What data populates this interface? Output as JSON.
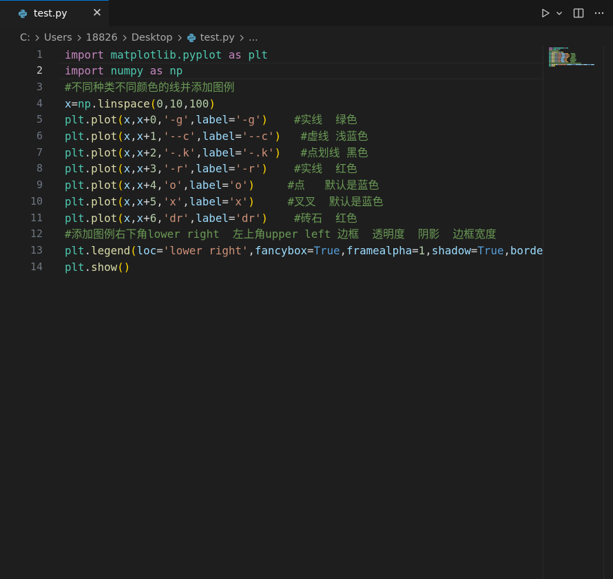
{
  "tab": {
    "label": "test.py",
    "close_glyph": "✕",
    "icon": "python-icon"
  },
  "toolbar": {
    "run_icon": "run-icon",
    "dropdown_icon": "chevron-down-icon",
    "split_icon": "split-editor-icon",
    "more_icon": "more-icon"
  },
  "breadcrumb": {
    "drive": "C:",
    "users": "Users",
    "user": "18826",
    "desktop": "Desktop",
    "file": "test.py",
    "more": "..."
  },
  "colors": {
    "accent": "#0078d4",
    "background": "#1e1e1e",
    "python_blue": "#519aba"
  },
  "editor": {
    "active_line": 2,
    "lines": [
      {
        "n": "1",
        "t": [
          [
            "kw",
            "import"
          ],
          [
            "op",
            " "
          ],
          [
            "mod",
            "matplotlib.pyplot"
          ],
          [
            "op",
            " "
          ],
          [
            "kw",
            "as"
          ],
          [
            "op",
            " "
          ],
          [
            "mod",
            "plt"
          ]
        ]
      },
      {
        "n": "2",
        "t": [
          [
            "kw",
            "import"
          ],
          [
            "op",
            " "
          ],
          [
            "mod",
            "numpy"
          ],
          [
            "op",
            " "
          ],
          [
            "kw",
            "as"
          ],
          [
            "op",
            " "
          ],
          [
            "mod",
            "np"
          ]
        ]
      },
      {
        "n": "3",
        "t": [
          [
            "cm",
            "#不同种类不同颜色的线并添加图例"
          ]
        ]
      },
      {
        "n": "4",
        "t": [
          [
            "var",
            "x"
          ],
          [
            "op",
            "="
          ],
          [
            "mod",
            "np"
          ],
          [
            "op",
            "."
          ],
          [
            "fn",
            "linspace"
          ],
          [
            "b1",
            "("
          ],
          [
            "num",
            "0"
          ],
          [
            "op",
            ","
          ],
          [
            "num",
            "10"
          ],
          [
            "op",
            ","
          ],
          [
            "num",
            "100"
          ],
          [
            "b1",
            ")"
          ]
        ]
      },
      {
        "n": "5",
        "t": [
          [
            "mod",
            "plt"
          ],
          [
            "op",
            "."
          ],
          [
            "fn",
            "plot"
          ],
          [
            "b1",
            "("
          ],
          [
            "var",
            "x"
          ],
          [
            "op",
            ","
          ],
          [
            "var",
            "x"
          ],
          [
            "op",
            "+"
          ],
          [
            "num",
            "0"
          ],
          [
            "op",
            ","
          ],
          [
            "str",
            "'-g'"
          ],
          [
            "op",
            ","
          ],
          [
            "var",
            "label"
          ],
          [
            "op",
            "="
          ],
          [
            "str",
            "'-g'"
          ],
          [
            "b1",
            ")"
          ],
          [
            "op",
            "    "
          ],
          [
            "cm",
            "#实线  绿色"
          ]
        ]
      },
      {
        "n": "6",
        "t": [
          [
            "mod",
            "plt"
          ],
          [
            "op",
            "."
          ],
          [
            "fn",
            "plot"
          ],
          [
            "b1",
            "("
          ],
          [
            "var",
            "x"
          ],
          [
            "op",
            ","
          ],
          [
            "var",
            "x"
          ],
          [
            "op",
            "+"
          ],
          [
            "num",
            "1"
          ],
          [
            "op",
            ","
          ],
          [
            "str",
            "'--c'"
          ],
          [
            "op",
            ","
          ],
          [
            "var",
            "label"
          ],
          [
            "op",
            "="
          ],
          [
            "str",
            "'--c'"
          ],
          [
            "b1",
            ")"
          ],
          [
            "op",
            "   "
          ],
          [
            "cm",
            "#虚线 浅蓝色"
          ]
        ]
      },
      {
        "n": "7",
        "t": [
          [
            "mod",
            "plt"
          ],
          [
            "op",
            "."
          ],
          [
            "fn",
            "plot"
          ],
          [
            "b1",
            "("
          ],
          [
            "var",
            "x"
          ],
          [
            "op",
            ","
          ],
          [
            "var",
            "x"
          ],
          [
            "op",
            "+"
          ],
          [
            "num",
            "2"
          ],
          [
            "op",
            ","
          ],
          [
            "str",
            "'-.k'"
          ],
          [
            "op",
            ","
          ],
          [
            "var",
            "label"
          ],
          [
            "op",
            "="
          ],
          [
            "str",
            "'-.k'"
          ],
          [
            "b1",
            ")"
          ],
          [
            "op",
            "   "
          ],
          [
            "cm",
            "#点划线 黑色"
          ]
        ]
      },
      {
        "n": "8",
        "t": [
          [
            "mod",
            "plt"
          ],
          [
            "op",
            "."
          ],
          [
            "fn",
            "plot"
          ],
          [
            "b1",
            "("
          ],
          [
            "var",
            "x"
          ],
          [
            "op",
            ","
          ],
          [
            "var",
            "x"
          ],
          [
            "op",
            "+"
          ],
          [
            "num",
            "3"
          ],
          [
            "op",
            ","
          ],
          [
            "str",
            "'-r'"
          ],
          [
            "op",
            ","
          ],
          [
            "var",
            "label"
          ],
          [
            "op",
            "="
          ],
          [
            "str",
            "'-r'"
          ],
          [
            "b1",
            ")"
          ],
          [
            "op",
            "    "
          ],
          [
            "cm",
            "#实线  红色"
          ]
        ]
      },
      {
        "n": "9",
        "t": [
          [
            "mod",
            "plt"
          ],
          [
            "op",
            "."
          ],
          [
            "fn",
            "plot"
          ],
          [
            "b1",
            "("
          ],
          [
            "var",
            "x"
          ],
          [
            "op",
            ","
          ],
          [
            "var",
            "x"
          ],
          [
            "op",
            "+"
          ],
          [
            "num",
            "4"
          ],
          [
            "op",
            ","
          ],
          [
            "str",
            "'o'"
          ],
          [
            "op",
            ","
          ],
          [
            "var",
            "label"
          ],
          [
            "op",
            "="
          ],
          [
            "str",
            "'o'"
          ],
          [
            "b1",
            ")"
          ],
          [
            "op",
            "     "
          ],
          [
            "cm",
            "#点   默认是蓝色"
          ]
        ]
      },
      {
        "n": "10",
        "t": [
          [
            "mod",
            "plt"
          ],
          [
            "op",
            "."
          ],
          [
            "fn",
            "plot"
          ],
          [
            "b1",
            "("
          ],
          [
            "var",
            "x"
          ],
          [
            "op",
            ","
          ],
          [
            "var",
            "x"
          ],
          [
            "op",
            "+"
          ],
          [
            "num",
            "5"
          ],
          [
            "op",
            ","
          ],
          [
            "str",
            "'x'"
          ],
          [
            "op",
            ","
          ],
          [
            "var",
            "label"
          ],
          [
            "op",
            "="
          ],
          [
            "str",
            "'x'"
          ],
          [
            "b1",
            ")"
          ],
          [
            "op",
            "     "
          ],
          [
            "cm",
            "#叉叉  默认是蓝色"
          ]
        ]
      },
      {
        "n": "11",
        "t": [
          [
            "mod",
            "plt"
          ],
          [
            "op",
            "."
          ],
          [
            "fn",
            "plot"
          ],
          [
            "b1",
            "("
          ],
          [
            "var",
            "x"
          ],
          [
            "op",
            ","
          ],
          [
            "var",
            "x"
          ],
          [
            "op",
            "+"
          ],
          [
            "num",
            "6"
          ],
          [
            "op",
            ","
          ],
          [
            "str",
            "'dr'"
          ],
          [
            "op",
            ","
          ],
          [
            "var",
            "label"
          ],
          [
            "op",
            "="
          ],
          [
            "str",
            "'dr'"
          ],
          [
            "b1",
            ")"
          ],
          [
            "op",
            "    "
          ],
          [
            "cm",
            "#砖石  红色"
          ]
        ]
      },
      {
        "n": "12",
        "t": [
          [
            "cm",
            "#添加图例右下角lower right  左上角upper left 边框  透明度  阴影  边框宽度"
          ]
        ]
      },
      {
        "n": "13",
        "t": [
          [
            "mod",
            "plt"
          ],
          [
            "op",
            "."
          ],
          [
            "fn",
            "legend"
          ],
          [
            "b1",
            "("
          ],
          [
            "var",
            "loc"
          ],
          [
            "op",
            "="
          ],
          [
            "str",
            "'lower right'"
          ],
          [
            "op",
            ","
          ],
          [
            "var",
            "fancybox"
          ],
          [
            "op",
            "="
          ],
          [
            "bool",
            "True"
          ],
          [
            "op",
            ","
          ],
          [
            "var",
            "framealpha"
          ],
          [
            "op",
            "="
          ],
          [
            "num",
            "1"
          ],
          [
            "op",
            ","
          ],
          [
            "var",
            "shadow"
          ],
          [
            "op",
            "="
          ],
          [
            "bool",
            "True"
          ],
          [
            "op",
            ","
          ],
          [
            "var",
            "borde"
          ]
        ]
      },
      {
        "n": "14",
        "t": [
          [
            "mod",
            "plt"
          ],
          [
            "op",
            "."
          ],
          [
            "fn",
            "show"
          ],
          [
            "b1",
            "()"
          ]
        ]
      }
    ]
  }
}
